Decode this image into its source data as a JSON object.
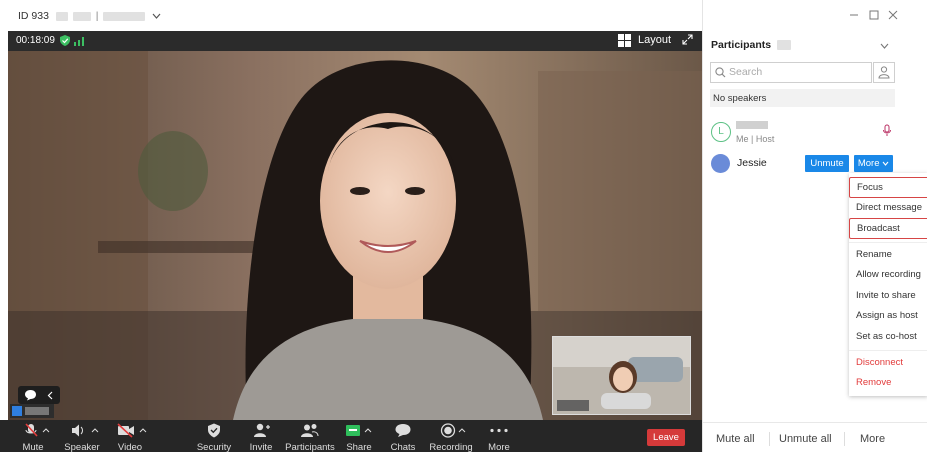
{
  "titlebar": {
    "meeting_id": "ID 933"
  },
  "meeting": {
    "duration": "00:18:09",
    "layout_label": "Layout"
  },
  "toolbar": {
    "mute": "Mute",
    "speaker": "Speaker",
    "video": "Video",
    "security": "Security",
    "invite": "Invite",
    "participants": "Participants",
    "share": "Share",
    "chats": "Chats",
    "recording": "Recording",
    "more": "More",
    "leave": "Leave"
  },
  "participants": {
    "title": "Participants",
    "search_placeholder": "Search",
    "no_speakers": "No speakers",
    "me": {
      "initial": "L",
      "role": "Me | Host"
    },
    "jessie": {
      "name": "Jessie",
      "unmute": "Unmute",
      "more": "More"
    }
  },
  "context_menu": {
    "items": [
      "Focus",
      "Direct message",
      "Broadcast",
      "Rename",
      "Allow recording",
      "Invite to share",
      "Assign as host",
      "Set as co-host"
    ],
    "danger_items": [
      "Disconnect",
      "Remove"
    ]
  },
  "footer": {
    "mute_all": "Mute all",
    "unmute_all": "Unmute all",
    "more": "More"
  },
  "colors": {
    "accent": "#1a88e8",
    "leave": "#d53a3a",
    "danger": "#e23b3b",
    "highlight_border": "#d64545"
  },
  "icons": [
    "shield-icon",
    "signal-icon",
    "layout-grid-icon",
    "expand-icon",
    "chevron-down-icon",
    "mic-muted-icon",
    "speaker-icon",
    "camera-off-icon",
    "shield-check-icon",
    "invite-icon",
    "participants-icon",
    "share-icon",
    "chat-icon",
    "record-icon",
    "more-dots-icon",
    "search-icon",
    "add-user-icon",
    "mic-icon",
    "minimize-icon",
    "maximize-icon",
    "close-icon"
  ]
}
